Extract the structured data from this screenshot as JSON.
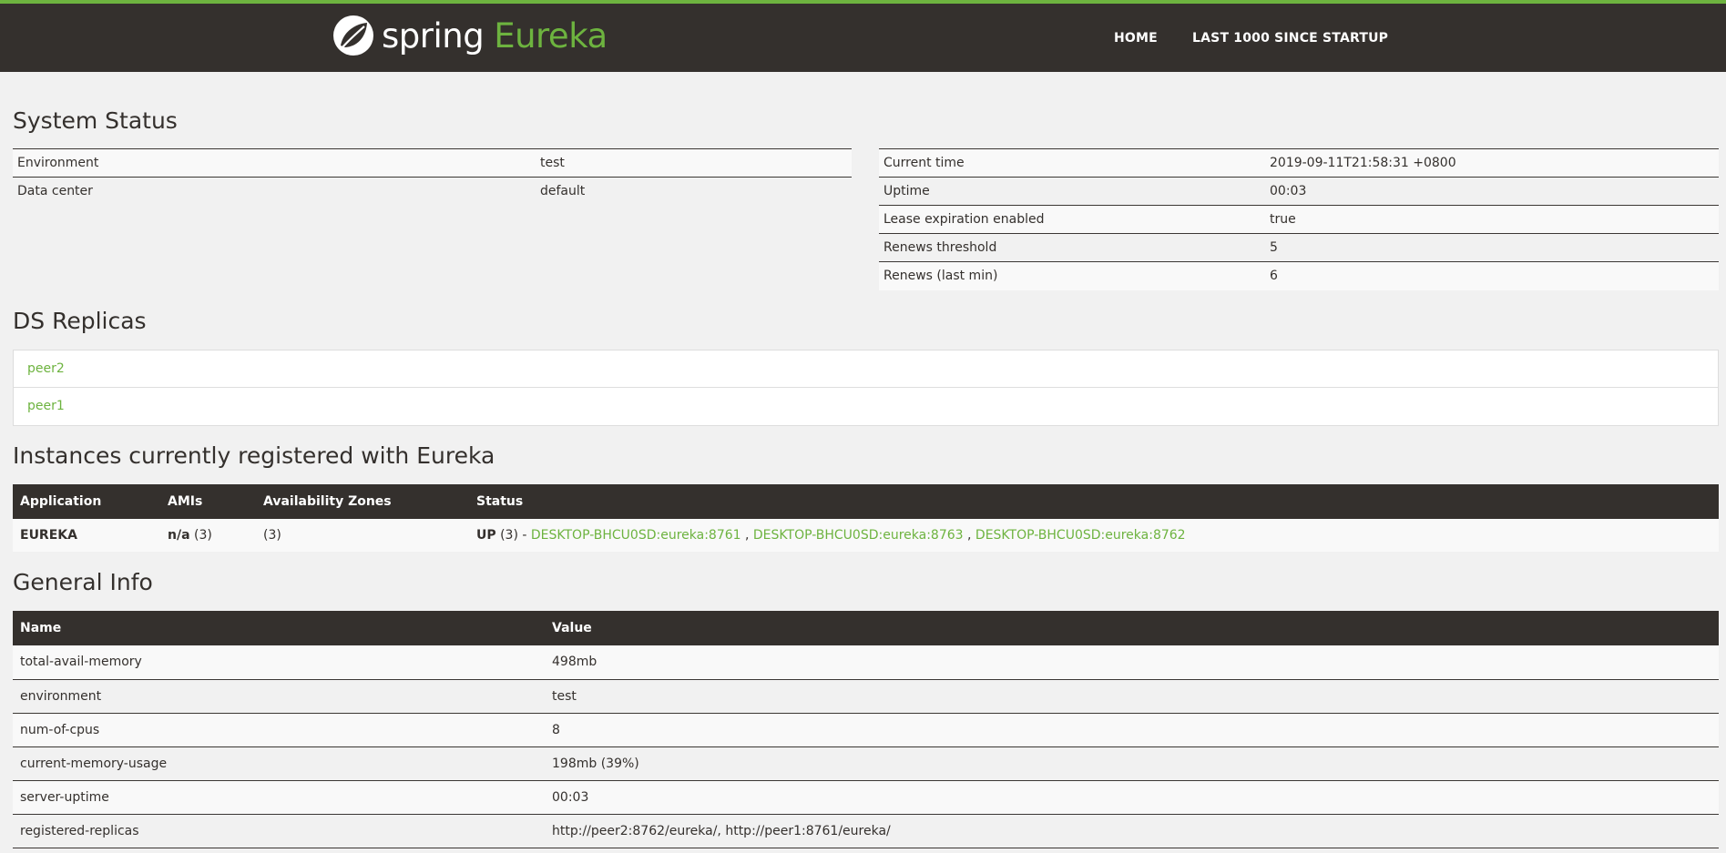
{
  "header": {
    "brand_spring": "spring",
    "brand_eureka": "Eureka",
    "nav": [
      {
        "label": "HOME"
      },
      {
        "label": "LAST 1000 SINCE STARTUP"
      }
    ],
    "accent_color": "#6db33f",
    "bar_color": "#34302d"
  },
  "system_status": {
    "title": "System Status",
    "left": [
      {
        "key": "Environment",
        "value": "test"
      },
      {
        "key": "Data center",
        "value": "default"
      }
    ],
    "right": [
      {
        "key": "Current time",
        "value": "2019-09-11T21:58:31 +0800"
      },
      {
        "key": "Uptime",
        "value": "00:03"
      },
      {
        "key": "Lease expiration enabled",
        "value": "true"
      },
      {
        "key": "Renews threshold",
        "value": "5"
      },
      {
        "key": "Renews (last min)",
        "value": "6"
      }
    ]
  },
  "ds_replicas": {
    "title": "DS Replicas",
    "items": [
      {
        "label": "peer2"
      },
      {
        "label": "peer1"
      }
    ]
  },
  "instances": {
    "title": "Instances currently registered with Eureka",
    "columns": [
      "Application",
      "AMIs",
      "Availability Zones",
      "Status"
    ],
    "rows": [
      {
        "application": "EUREKA",
        "amis_bold": "n/a",
        "amis_count": "(3)",
        "zones": "(3)",
        "status_bold": "UP",
        "status_count": "(3) -",
        "links": [
          "DESKTOP-BHCU0SD:eureka:8761",
          "DESKTOP-BHCU0SD:eureka:8763",
          "DESKTOP-BHCU0SD:eureka:8762"
        ],
        "separator": ","
      }
    ]
  },
  "general_info": {
    "title": "General Info",
    "columns": [
      "Name",
      "Value"
    ],
    "rows": [
      {
        "name": "total-avail-memory",
        "value": "498mb"
      },
      {
        "name": "environment",
        "value": "test"
      },
      {
        "name": "num-of-cpus",
        "value": "8"
      },
      {
        "name": "current-memory-usage",
        "value": "198mb (39%)"
      },
      {
        "name": "server-uptime",
        "value": "00:03"
      },
      {
        "name": "registered-replicas",
        "value": "http://peer2:8762/eureka/, http://peer1:8761/eureka/"
      }
    ]
  }
}
